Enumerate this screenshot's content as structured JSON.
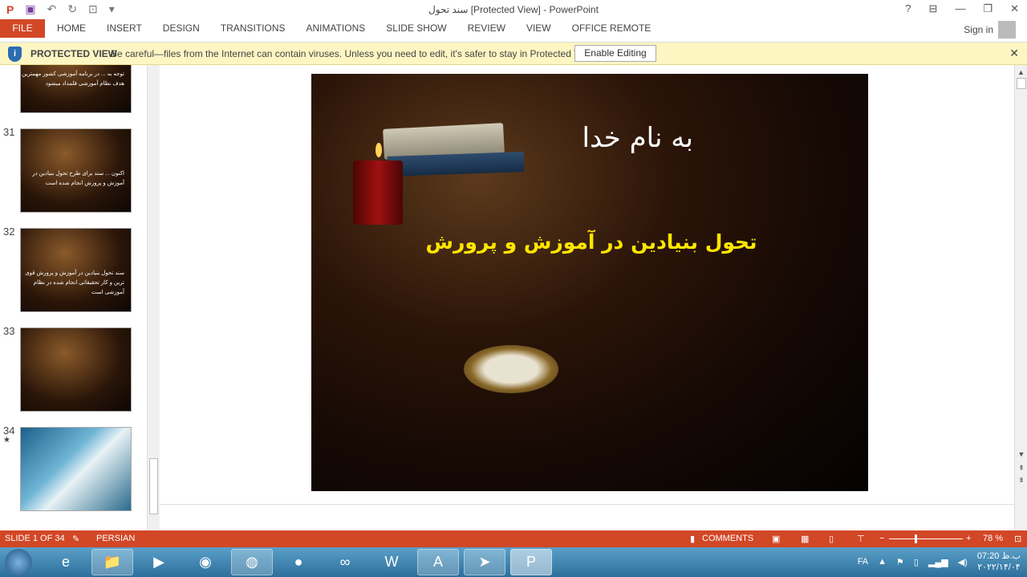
{
  "window": {
    "title": "سند تحول [Protected View] - PowerPoint",
    "help": "?",
    "controls": [
      "restore-ribbon",
      "minimize",
      "maximize",
      "close"
    ]
  },
  "ribbon": {
    "file": "FILE",
    "tabs": [
      "HOME",
      "INSERT",
      "DESIGN",
      "TRANSITIONS",
      "ANIMATIONS",
      "SLIDE SHOW",
      "REVIEW",
      "VIEW",
      "OFFICE REMOTE"
    ],
    "sign_in": "Sign in"
  },
  "protected_view": {
    "label": "PROTECTED VIEW",
    "message": "Be careful—files from the Internet can contain viruses. Unless you need to edit, it's safer to stay in Protected View.",
    "button": "Enable Editing",
    "close": "✕"
  },
  "thumbnails": [
    {
      "number": "",
      "text": "توجه به ... در برنامه آموزشی کشور مهمترین هدف نظام آموزشی قلمداد میشود"
    },
    {
      "number": "31",
      "text": "اکنون ... سند برای طرح تحول بنیادین در آموزش و پرورش انجام شده است"
    },
    {
      "number": "32",
      "text": "سند تحول بنیادین در آموزش و پرورش قوی ترین و کار تحقیقاتی انجام شده در نظام آموزشی است"
    },
    {
      "number": "33",
      "text": ""
    },
    {
      "number": "34",
      "text": "",
      "star": "★"
    }
  ],
  "slide": {
    "title": "به نام خدا",
    "subtitle": "تحول بنیادین در آموزش و پرورش"
  },
  "status": {
    "slide": "SLIDE 1 OF 34",
    "language": "PERSIAN",
    "comments": "COMMENTS",
    "zoom": "78 %",
    "zoom_percent": 78
  },
  "taskbar": {
    "apps": [
      "internet-explorer",
      "file-explorer",
      "media-player",
      "chrome",
      "firefox",
      "media-app",
      "app",
      "word",
      "acrobat",
      "telegram",
      "powerpoint"
    ],
    "language": "FA",
    "time": "07:20 ب.ظ",
    "date": "۲۰۲۲/۱۴/۰۴"
  }
}
